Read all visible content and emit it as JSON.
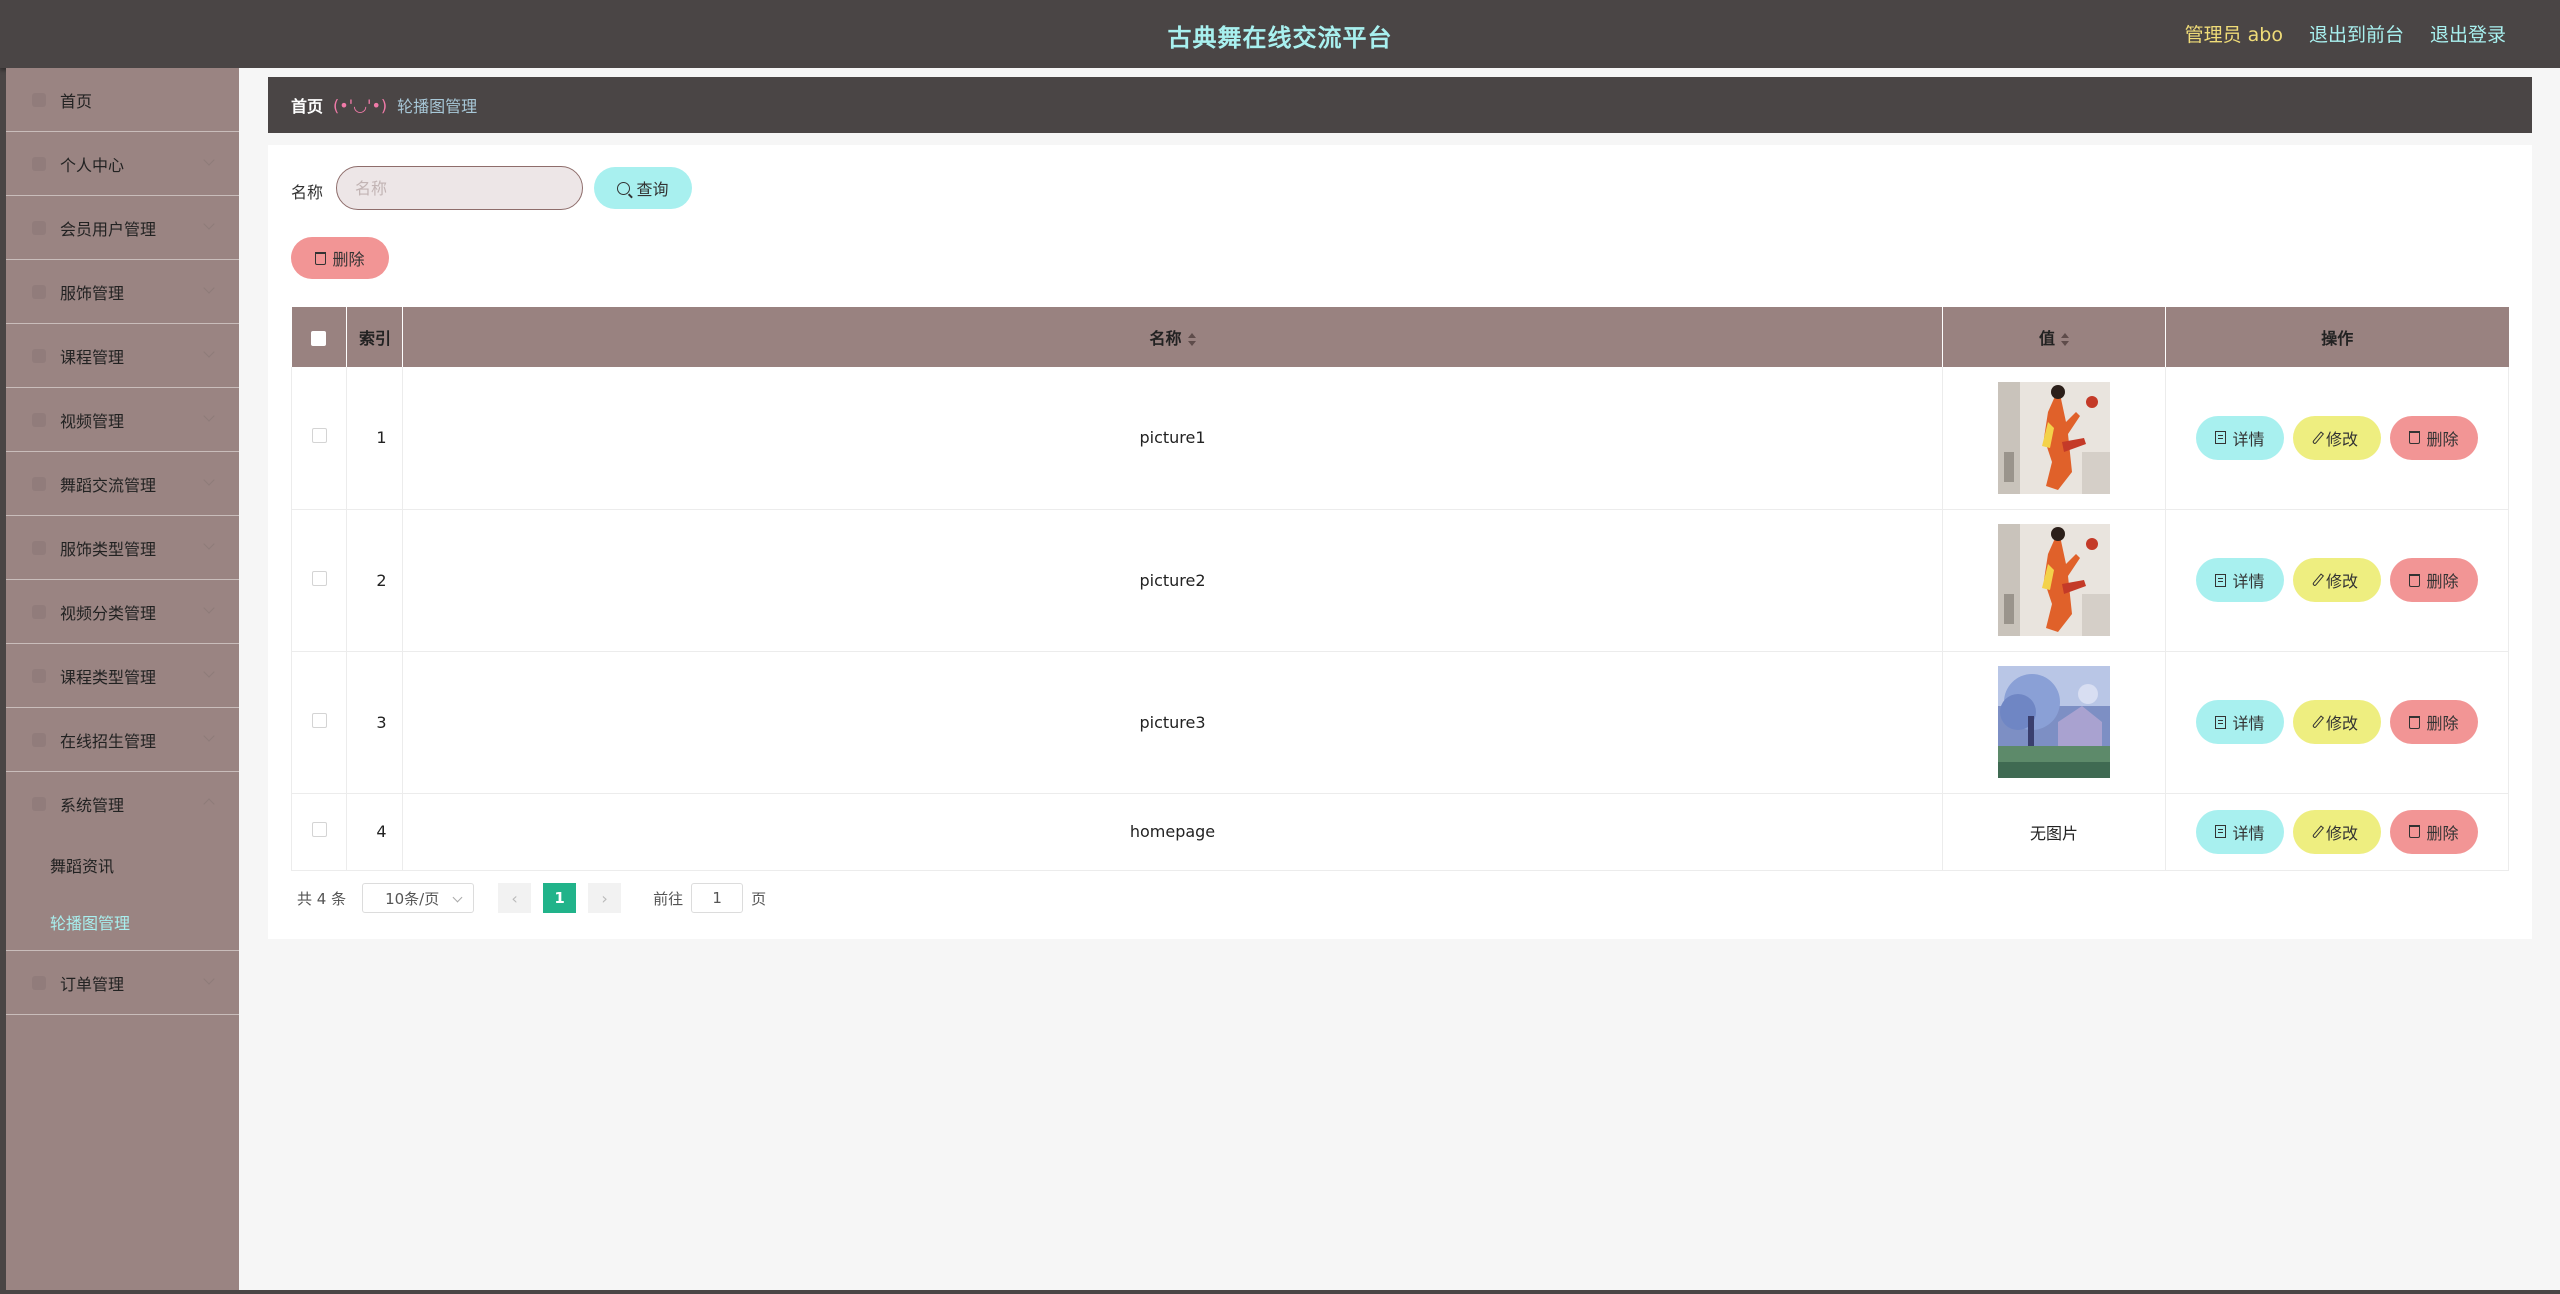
{
  "header": {
    "title": "古典舞在线交流平台",
    "admin": "管理员 abo",
    "to_front": "退出到前台",
    "logout": "退出登录"
  },
  "sidebar": {
    "items": [
      {
        "label": "首页",
        "icon": "home-icon"
      },
      {
        "label": "个人中心",
        "icon": "user-icon"
      },
      {
        "label": "会员用户管理",
        "icon": "members-icon"
      },
      {
        "label": "服饰管理",
        "icon": "clothing-icon"
      },
      {
        "label": "课程管理",
        "icon": "course-icon"
      },
      {
        "label": "视频管理",
        "icon": "video-icon"
      },
      {
        "label": "舞蹈交流管理",
        "icon": "dance-icon"
      },
      {
        "label": "服饰类型管理",
        "icon": "clothing-type-icon"
      },
      {
        "label": "视频分类管理",
        "icon": "video-category-icon"
      },
      {
        "label": "课程类型管理",
        "icon": "course-type-icon"
      },
      {
        "label": "在线招生管理",
        "icon": "enroll-icon"
      },
      {
        "label": "系统管理",
        "icon": "system-icon"
      },
      {
        "label": "订单管理",
        "icon": "order-icon"
      }
    ],
    "system_sub": [
      {
        "label": "舞蹈资讯"
      },
      {
        "label": "轮播图管理"
      }
    ]
  },
  "breadcrumb": {
    "home": "首页",
    "face": "(•'◡'•)",
    "current": "轮播图管理"
  },
  "search": {
    "label": "名称",
    "placeholder": "名称",
    "query_button": "查询"
  },
  "bulk_delete": "删除",
  "table": {
    "headers": {
      "index": "索引",
      "name": "名称",
      "value": "值",
      "ops": "操作"
    },
    "rows": [
      {
        "index": "1",
        "name": "picture1",
        "value": "image",
        "thumb": "dancer"
      },
      {
        "index": "2",
        "name": "picture2",
        "value": "image",
        "thumb": "dancer"
      },
      {
        "index": "3",
        "name": "picture3",
        "value": "image",
        "thumb": "landscape"
      },
      {
        "index": "4",
        "name": "homepage",
        "value": "无图片",
        "thumb": "none"
      }
    ],
    "ops": {
      "detail": "详情",
      "edit": "修改",
      "delete": "删除"
    }
  },
  "pagination": {
    "total": "共 4 条",
    "page_size": "10条/页",
    "prev": "‹",
    "current": "1",
    "next": "›",
    "goto": "前往",
    "goto_value": "1",
    "page_unit": "页"
  },
  "colors": {
    "topbar": "#4a4545",
    "sidebar": "#9a8482",
    "accent_cyan": "#a8f0ef",
    "accent_yellow": "#eeee80",
    "accent_red": "#f29595",
    "table_header": "#998280",
    "pager_active": "#21b38a"
  }
}
